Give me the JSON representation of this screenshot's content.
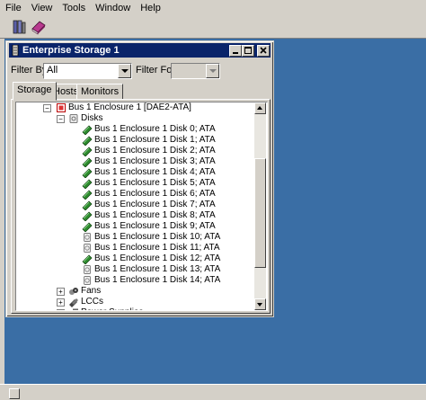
{
  "menubar": {
    "items": [
      {
        "label": "File",
        "name": "menu-file"
      },
      {
        "label": "View",
        "name": "menu-view"
      },
      {
        "label": "Tools",
        "name": "menu-tools"
      },
      {
        "label": "Window",
        "name": "menu-window"
      },
      {
        "label": "Help",
        "name": "menu-help"
      }
    ]
  },
  "toolbar": {
    "buttons": [
      {
        "icon": "storage-system-icon"
      },
      {
        "icon": "book-icon"
      }
    ]
  },
  "window": {
    "title": "Enterprise Storage 1",
    "filter_by_label": "Filter By:",
    "filter_by_value": "All",
    "filter_for_label": "Filter For:",
    "filter_for_value": "",
    "tabs": [
      "Storage",
      "Hosts",
      "Monitors"
    ],
    "active_tab": "Storage"
  },
  "tree": {
    "enclosure": "Bus 1 Enclosure 1 [DAE2-ATA]",
    "disks_label": "Disks",
    "disks": [
      {
        "label": "Bus 1 Enclosure 1 Disk 0; ATA",
        "status": "normal"
      },
      {
        "label": "Bus 1 Enclosure 1 Disk 1; ATA",
        "status": "normal"
      },
      {
        "label": "Bus 1 Enclosure 1 Disk 2; ATA",
        "status": "normal"
      },
      {
        "label": "Bus 1 Enclosure 1 Disk 3; ATA",
        "status": "normal"
      },
      {
        "label": "Bus 1 Enclosure 1 Disk 4; ATA",
        "status": "normal"
      },
      {
        "label": "Bus 1 Enclosure 1 Disk 5; ATA",
        "status": "normal"
      },
      {
        "label": "Bus 1 Enclosure 1 Disk 6; ATA",
        "status": "normal"
      },
      {
        "label": "Bus 1 Enclosure 1 Disk 7; ATA",
        "status": "normal"
      },
      {
        "label": "Bus 1 Enclosure 1 Disk 8; ATA",
        "status": "normal"
      },
      {
        "label": "Bus 1 Enclosure 1 Disk 9; ATA",
        "status": "normal"
      },
      {
        "label": "Bus 1 Enclosure 1 Disk 10; ATA",
        "status": "empty"
      },
      {
        "label": "Bus 1 Enclosure 1 Disk 11; ATA",
        "status": "empty"
      },
      {
        "label": "Bus 1 Enclosure 1 Disk 12; ATA",
        "status": "normal"
      },
      {
        "label": "Bus 1 Enclosure 1 Disk 13; ATA",
        "status": "empty"
      },
      {
        "label": "Bus 1 Enclosure 1 Disk 14; ATA",
        "status": "empty"
      }
    ],
    "fans_label": "Fans",
    "lccs_label": "LCCs",
    "power_supplies_label": "Power Supplies"
  },
  "colors": {
    "desktop": "#3a6ea5",
    "titlebar": "#0a246a",
    "disk_normal": "#2e8b2e",
    "disk_empty": "#7a7a7a"
  }
}
